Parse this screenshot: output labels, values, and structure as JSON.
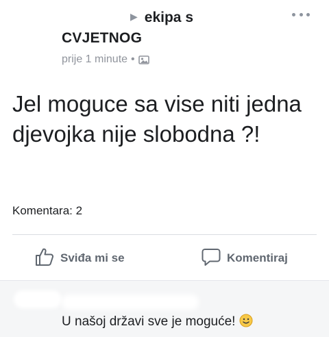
{
  "post": {
    "author_line": "ekipa s",
    "group_name": "CVJETNOG",
    "time": "prije 1 minute",
    "separator": "•",
    "privacy_icon": "photo-privacy-icon",
    "text": "Jel moguce sa vise niti jedna djevojka nije slobodna ?!",
    "comments_count": "Komentara: 2"
  },
  "actions": {
    "like_label": "Sviđa mi se",
    "comment_label": "Komentiraj"
  },
  "comment": {
    "text": "U našoj državi sve je moguće!",
    "emoji": "slightly-smiling-face-icon"
  },
  "colors": {
    "text": "#1c1e21",
    "meta": "#90949c",
    "action": "#606770",
    "comment_bg": "#f5f6f7",
    "emoji_face": "#f7c948"
  }
}
